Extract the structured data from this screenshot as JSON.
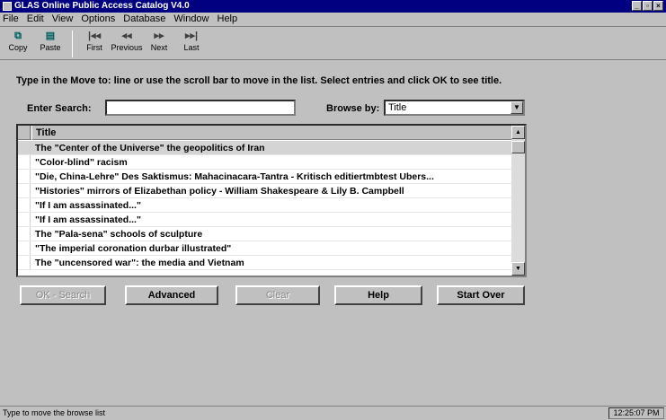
{
  "window": {
    "title": "GLAS Online Public Access Catalog V4.0"
  },
  "menubar": {
    "items": [
      {
        "label": "File"
      },
      {
        "label": "Edit"
      },
      {
        "label": "View"
      },
      {
        "label": "Options"
      },
      {
        "label": "Database"
      },
      {
        "label": "Window"
      },
      {
        "label": "Help"
      }
    ]
  },
  "toolbar": {
    "buttons": [
      {
        "label": "Copy",
        "icon": "copy-icon"
      },
      {
        "label": "Paste",
        "icon": "paste-icon"
      },
      {
        "label": "First",
        "icon": "first-icon"
      },
      {
        "label": "Previous",
        "icon": "previous-icon"
      },
      {
        "label": "Next",
        "icon": "next-icon"
      },
      {
        "label": "Last",
        "icon": "last-icon"
      }
    ]
  },
  "instructions": "Type in the Move to: line or use the scroll bar to move in the list. Select entries and click OK to see title.",
  "search": {
    "label": "Enter Search:",
    "value": ""
  },
  "browse": {
    "label": "Browse by:",
    "selected": "Title"
  },
  "list": {
    "header": "Title",
    "rows": [
      "The \"Center of the Universe\" the geopolitics of Iran",
      "\"Color-blind\" racism",
      "\"Die, China-Lehre\" Des Saktismus: Mahacinacara-Tantra - Kritisch editiertmbtest Ubers...",
      "\"Histories\" mirrors of Elizabethan policy - William Shakespeare & Lily B. Campbell",
      "\"If I am assassinated...\"",
      "\"If I am assassinated...\"",
      "The \"Pala-sena\" schools of sculpture",
      "\"The imperial coronation durbar illustrated\"",
      "The \"uncensored war\": the media and  Vietnam"
    ]
  },
  "buttons": {
    "ok_search": "OK - Search",
    "advanced": "Advanced",
    "clear": "Clear",
    "help": "Help",
    "start_over": "Start Over"
  },
  "status": {
    "text": "Type to move the browse list",
    "time": "12:25:07 PM"
  }
}
